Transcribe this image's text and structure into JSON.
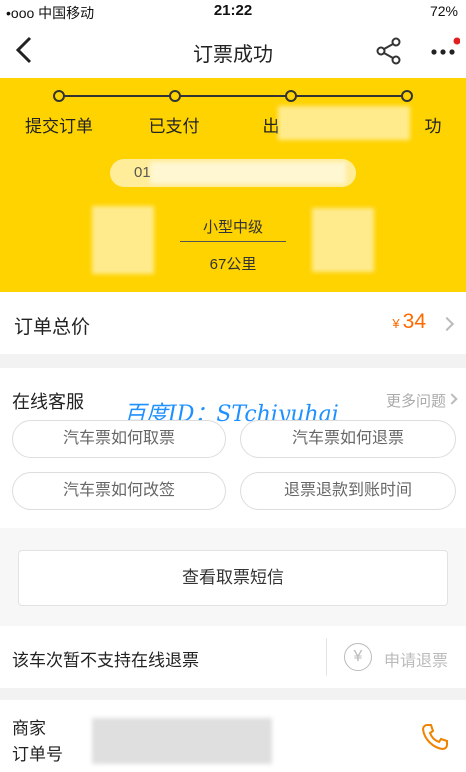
{
  "status_bar": {
    "carrier": "•ooo 中国移动",
    "time": "21:22",
    "battery": "72%"
  },
  "navbar": {
    "title": "订票成功"
  },
  "progress": {
    "steps": [
      "提交订单",
      "已支付",
      "出",
      "功"
    ],
    "pill_text": "01",
    "route_type": "小型中级",
    "distance": "67公里"
  },
  "price": {
    "label": "订单总价",
    "currency": "¥",
    "amount": "34"
  },
  "service": {
    "label": "在线客服",
    "more_questions": "更多问题",
    "watermark": "百度ID：STchiyuhai",
    "questions": [
      "汽车票如何取票",
      "汽车票如何退票",
      "汽车票如何改签",
      "退票退款到账时间"
    ]
  },
  "sms": {
    "label": "查看取票短信"
  },
  "refund": {
    "notice": "该车次暂不支持在线退票",
    "button_label": "申请退票",
    "icon_glyph": "¥"
  },
  "merchant": {
    "merchant_label": "商家",
    "order_label": "订单号"
  },
  "colors": {
    "accent_yellow": "#ffd300",
    "price_orange": "#ff6a00",
    "phone_orange": "#f08300"
  }
}
